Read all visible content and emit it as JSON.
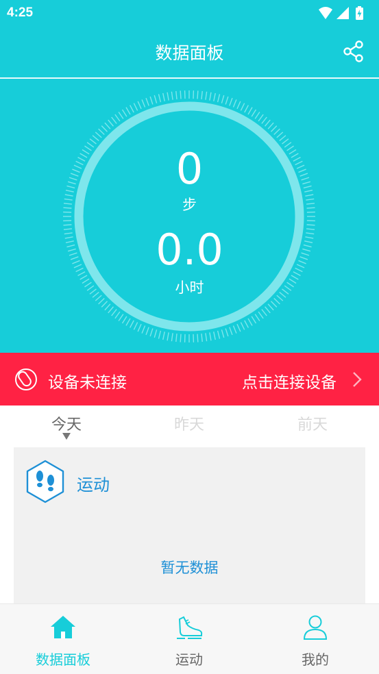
{
  "statusbar": {
    "time": "4:25"
  },
  "appbar": {
    "title": "数据面板"
  },
  "dial": {
    "steps": "0",
    "steps_unit": "步",
    "hours": "0.0",
    "hours_unit": "小时"
  },
  "connect": {
    "status": "设备未连接",
    "action": "点击连接设备"
  },
  "day_tabs": [
    {
      "label": "今天"
    },
    {
      "label": "昨天"
    },
    {
      "label": "前天"
    }
  ],
  "card": {
    "title": "运动",
    "empty_text": "暂无数据"
  },
  "nav": [
    {
      "label": "数据面板"
    },
    {
      "label": "运动"
    },
    {
      "label": "我的"
    }
  ],
  "colors": {
    "accent": "#17cdd9",
    "banner": "#ff2244",
    "link_blue": "#1e90d6"
  },
  "icons": [
    "wifi-icon",
    "signal-icon",
    "battery-icon",
    "share-icon",
    "band-icon",
    "chevron-right-icon",
    "footprints-icon",
    "home-icon",
    "shoe-icon",
    "person-icon"
  ]
}
